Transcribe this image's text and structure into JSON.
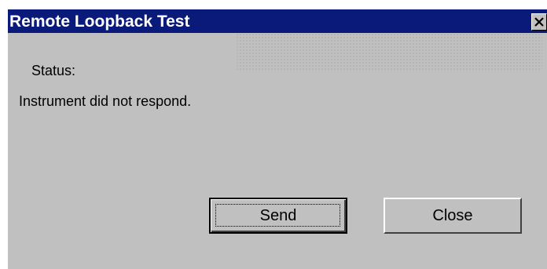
{
  "window": {
    "title": "Remote Loopback Test",
    "close_glyph": "✕",
    "colors": {
      "titlebar": "#0a1a7a",
      "face": "#c0c0c0"
    }
  },
  "status": {
    "label": "Status:",
    "message": "Instrument did not respond."
  },
  "buttons": {
    "send_label": "Send",
    "close_label": "Close"
  }
}
